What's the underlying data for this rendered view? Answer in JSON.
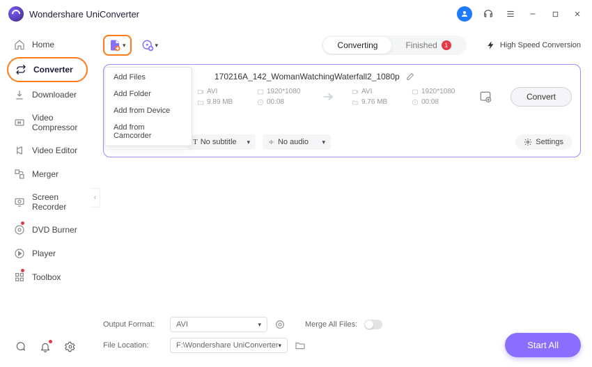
{
  "app": {
    "title": "Wondershare UniConverter"
  },
  "sidebar": {
    "items": [
      {
        "label": "Home"
      },
      {
        "label": "Converter"
      },
      {
        "label": "Downloader"
      },
      {
        "label": "Video Compressor"
      },
      {
        "label": "Video Editor"
      },
      {
        "label": "Merger"
      },
      {
        "label": "Screen Recorder"
      },
      {
        "label": "DVD Burner"
      },
      {
        "label": "Player"
      },
      {
        "label": "Toolbox"
      }
    ]
  },
  "toolbar": {
    "tabs": {
      "converting": "Converting",
      "finished": "Finished",
      "finished_count": "1"
    },
    "hsc": "High Speed Conversion",
    "dropdown": [
      "Add Files",
      "Add Folder",
      "Add from Device",
      "Add from Camcorder"
    ]
  },
  "file": {
    "name": "170216A_142_WomanWatchingWaterfall2_1080p",
    "src": {
      "format": "AVI",
      "resolution": "1920*1080",
      "size": "9.89 MB",
      "duration": "00:08"
    },
    "dst": {
      "format": "AVI",
      "resolution": "1920*1080",
      "size": "9.76 MB",
      "duration": "00:08"
    },
    "subtitle": "No subtitle",
    "audio": "No audio",
    "convert": "Convert",
    "settings": "Settings"
  },
  "footer": {
    "output_format_label": "Output Format:",
    "output_format": "AVI",
    "merge_label": "Merge All Files:",
    "location_label": "File Location:",
    "location": "F:\\Wondershare UniConverter",
    "start_all": "Start All"
  }
}
